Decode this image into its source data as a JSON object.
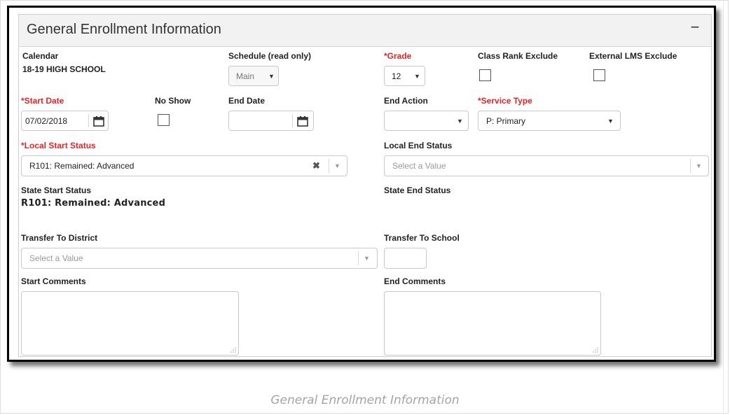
{
  "panel": {
    "title": "General Enrollment Information",
    "collapse_symbol": "−"
  },
  "fields": {
    "calendar": {
      "label": "Calendar",
      "value": "18-19 HIGH SCHOOL"
    },
    "schedule": {
      "label": "Schedule (read only)",
      "value": "Main"
    },
    "grade": {
      "label": "Grade",
      "value": "12"
    },
    "class_rank_exclude": {
      "label": "Class Rank Exclude",
      "checked": false
    },
    "external_lms_exclude": {
      "label": "External LMS Exclude",
      "checked": false
    },
    "start_date": {
      "label": "Start Date",
      "value": "07/02/2018"
    },
    "no_show": {
      "label": "No Show",
      "checked": false
    },
    "end_date": {
      "label": "End Date",
      "value": ""
    },
    "end_action": {
      "label": "End Action",
      "value": ""
    },
    "service_type": {
      "label": "Service Type",
      "value": "P: Primary"
    },
    "local_start_status": {
      "label": "Local Start Status",
      "value": "R101: Remained: Advanced"
    },
    "local_end_status": {
      "label": "Local End Status",
      "placeholder": "Select a Value"
    },
    "state_start_status": {
      "label": "State Start Status",
      "value": "R101: Remained: Advanced"
    },
    "state_end_status": {
      "label": "State End Status"
    },
    "transfer_to_district": {
      "label": "Transfer To District",
      "placeholder": "Select a Value"
    },
    "transfer_to_school": {
      "label": "Transfer To School",
      "value": ""
    },
    "start_comments": {
      "label": "Start Comments"
    },
    "end_comments": {
      "label": "End Comments"
    }
  },
  "required_marker": "*",
  "caption": "General Enrollment Information",
  "colors": {
    "required": "#e3262a",
    "header_bg": "#f2f2f2",
    "border": "#c9c9c9"
  }
}
